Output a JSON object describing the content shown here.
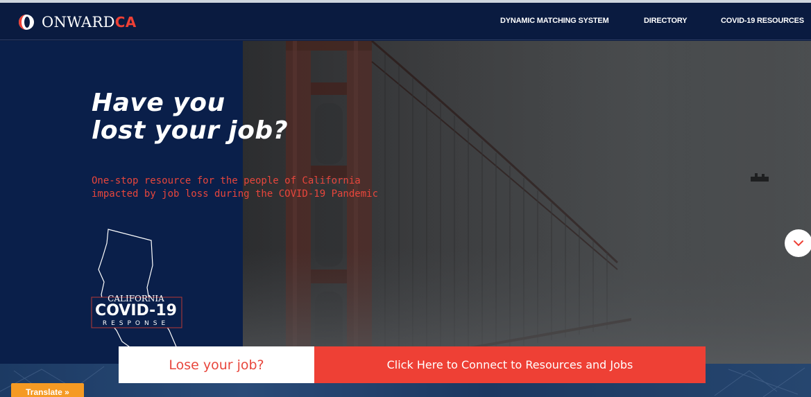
{
  "brand": {
    "name_prefix": "ONWARD",
    "name_accent": "CA",
    "logo_icon": "onward-logo-icon",
    "accent_color": "#ee4035",
    "navy_color": "#0a1b40"
  },
  "nav": {
    "items": [
      {
        "label": "DYNAMIC MATCHING SYSTEM"
      },
      {
        "label": "DIRECTORY"
      },
      {
        "label": "COVID-19 RESOURCES"
      }
    ]
  },
  "hero": {
    "headline_line1": "Have you",
    "headline_line2": "lost your job?",
    "subtext": "One-stop resource for the people of California impacted by job loss during the COVID-19 Pandemic",
    "badge": {
      "line1": "CALIFORNIA",
      "line2": "COVID-19",
      "line3": "RESPONSE"
    },
    "scroll_icon": "chevron-down-icon"
  },
  "cta": {
    "question": "Lose your job?",
    "button_label": "Click Here to Connect to Resources and Jobs"
  },
  "translate": {
    "label": "Translate »",
    "color": "#f59a23"
  }
}
